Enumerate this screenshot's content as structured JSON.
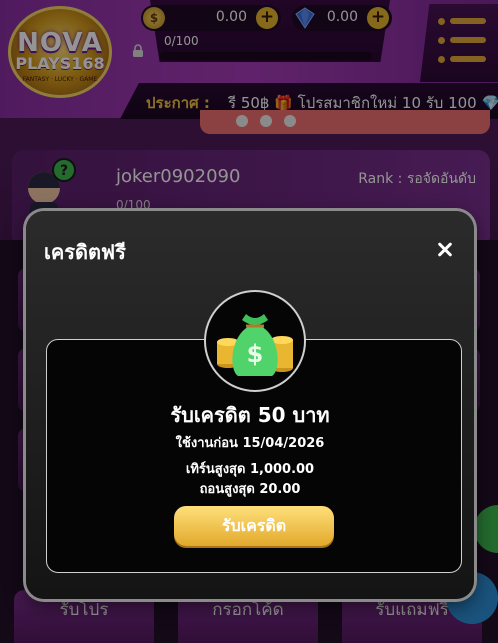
{
  "logo": {
    "line1": "NOVA",
    "line2": "PLAYS168",
    "tagline": "FANTASY · LUCKY · GAME"
  },
  "wallet": {
    "coin_symbol": "$",
    "coin_value": "0.00",
    "gem_value": "0.00",
    "plus_label": "+"
  },
  "level": {
    "text": "0/100",
    "progress": 0
  },
  "marquee": {
    "label": "ประกาศ :",
    "text": "รี 50฿ 🎁 โปรสมาชิกใหม่ 10 รับ 100 💎"
  },
  "profile": {
    "username": "joker0902090",
    "rank": "Rank : รอจัดอันดับ",
    "exp": "0/100",
    "help_mark": "?"
  },
  "bottom_tabs": [
    "รับโปร",
    "กรอกโค้ด",
    "รับแถมฟรี"
  ],
  "modal": {
    "title": "เครดิตฟรี",
    "reward_title": "รับเครดิต 50 บาท",
    "expires": "ใช้งานก่อน 15/04/2026",
    "min_turnover": "เทิร์นสูงสุด 1,000.00",
    "max_withdraw": "ถอนสูงสุด 20.00",
    "claim_label": "รับเครดิต",
    "bag_symbol": "$"
  },
  "colors": {
    "accent_gold": "#f3c540",
    "header_purple": "#a63db8",
    "modal_bg": "#141414"
  }
}
